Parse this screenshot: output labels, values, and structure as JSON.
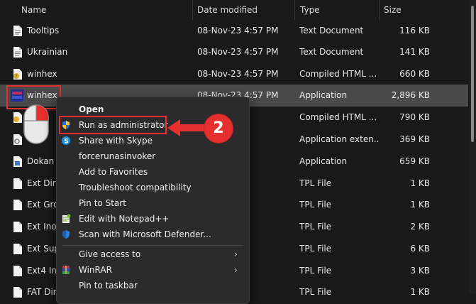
{
  "columns": {
    "name": "Name",
    "date": "Date modified",
    "type": "Type",
    "size": "Size"
  },
  "rows": [
    {
      "name": "Tooltips",
      "date": "08-Nov-23 4:57 PM",
      "type": "Text Document",
      "size": "116 KB",
      "icon": "text-file-icon"
    },
    {
      "name": "Ukrainian",
      "date": "08-Nov-23 4:57 PM",
      "type": "Text Document",
      "size": "141 KB",
      "icon": "text-file-icon"
    },
    {
      "name": "winhex",
      "date": "08-Nov-23 4:57 PM",
      "type": "Compiled HTML ...",
      "size": "660 KB",
      "icon": "help-file-icon"
    },
    {
      "name": "winhex",
      "date": "08-Nov-23 4:57 PM",
      "type": "Application",
      "size": "2,896 KB",
      "icon": "winhex-app-icon",
      "selected": true
    },
    {
      "name": "",
      "date": "",
      "type": "Compiled HTML ...",
      "size": "790 KB",
      "icon": "help-file-icon"
    },
    {
      "name": "",
      "date": "",
      "type": "Application exten...",
      "size": "369 KB",
      "icon": "dll-file-icon"
    },
    {
      "name": "Dokan",
      "date": "",
      "type": "Application",
      "size": "659 KB",
      "icon": "app-file-icon"
    },
    {
      "name": "Ext Dir",
      "date": "",
      "type": "TPL File",
      "size": "1 KB",
      "icon": "blank-file-icon"
    },
    {
      "name": "Ext Gro",
      "date": "",
      "type": "TPL File",
      "size": "1 KB",
      "icon": "blank-file-icon"
    },
    {
      "name": "Ext Ino",
      "date": "",
      "type": "TPL File",
      "size": "2 KB",
      "icon": "blank-file-icon"
    },
    {
      "name": "Ext Sup",
      "date": "",
      "type": "TPL File",
      "size": "6 KB",
      "icon": "blank-file-icon"
    },
    {
      "name": "Ext4 In",
      "date": "",
      "type": "TPL File",
      "size": "3 KB",
      "icon": "blank-file-icon"
    },
    {
      "name": "FAT Dir",
      "date": "",
      "type": "TPL File",
      "size": "1 KB",
      "icon": "blank-file-icon"
    }
  ],
  "context_menu": {
    "items": [
      {
        "label": "Open",
        "bold": true,
        "icon": ""
      },
      {
        "label": "Run as administrator",
        "icon": "uac-shield-icon"
      },
      {
        "label": "Share with Skype",
        "icon": "skype-icon"
      },
      {
        "label": "forcerunasinvoker",
        "icon": ""
      },
      {
        "label": "Add to Favorites",
        "icon": ""
      },
      {
        "label": "Troubleshoot compatibility",
        "icon": ""
      },
      {
        "label": "Pin to Start",
        "icon": ""
      },
      {
        "label": "Edit with Notepad++",
        "icon": "notepad-plus-plus-icon"
      },
      {
        "label": "Scan with Microsoft Defender...",
        "icon": "defender-shield-icon"
      },
      {
        "label": "Give access to",
        "icon": "",
        "submenu": true
      },
      {
        "label": "WinRAR",
        "icon": "winrar-icon",
        "submenu": true
      },
      {
        "label": "Pin to taskbar",
        "icon": ""
      }
    ],
    "chevron": "›"
  },
  "annotation": {
    "step_number": "2"
  },
  "colors": {
    "accent_red": "#e5302f",
    "selection": "#4a4a4a",
    "menu_bg": "#2b2b2b"
  }
}
